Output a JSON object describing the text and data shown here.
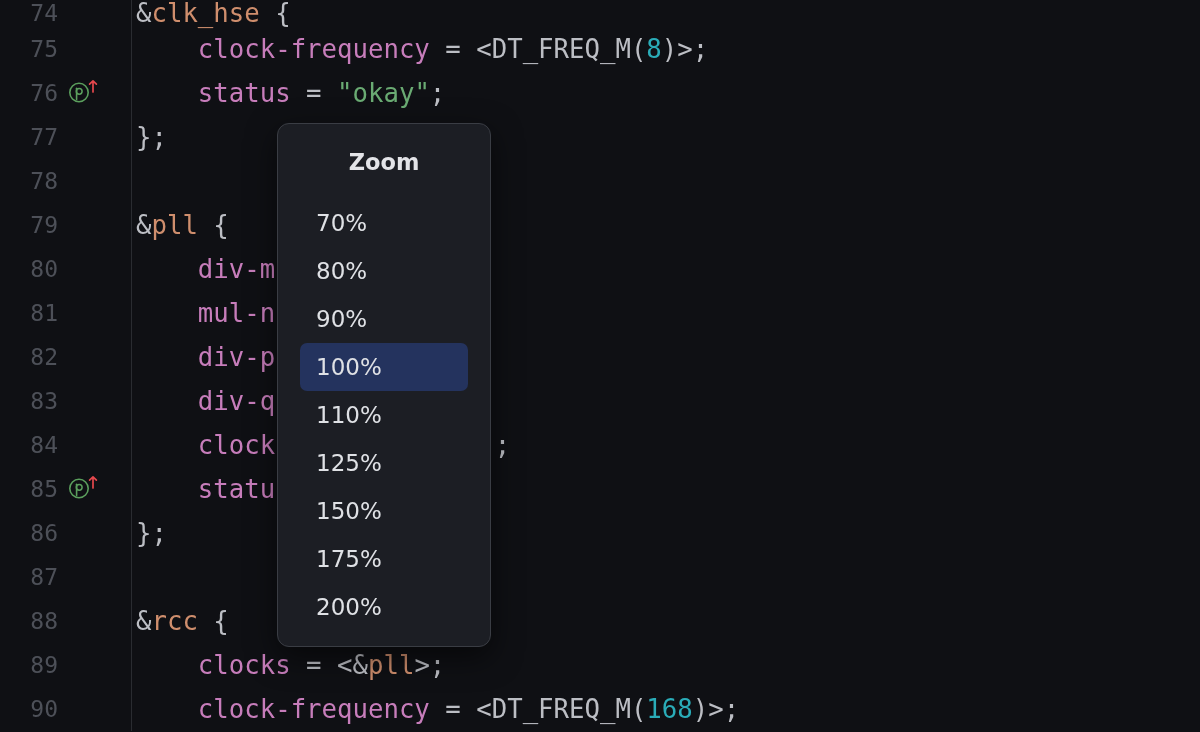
{
  "editor": {
    "lines": [
      {
        "number": "74",
        "marker": false,
        "tokens": [
          {
            "text": "&",
            "kind": "plain"
          },
          {
            "text": "clk_hse",
            "kind": "label"
          },
          {
            "text": " {",
            "kind": "plain"
          }
        ],
        "children": [
          {
            "number": "75",
            "marker": false,
            "tokens": [
              {
                "text": "clock-frequency",
                "kind": "property"
              },
              {
                "text": " = <DT_FREQ_M(",
                "kind": "plain"
              },
              {
                "text": "8",
                "kind": "number"
              },
              {
                "text": ")>;",
                "kind": "plain"
              }
            ]
          },
          {
            "number": "76",
            "marker": true,
            "tokens": [
              {
                "text": "status",
                "kind": "property"
              },
              {
                "text": " = ",
                "kind": "plain"
              },
              {
                "text": "\"okay\"",
                "kind": "string"
              },
              {
                "text": ";",
                "kind": "plain"
              }
            ]
          }
        ]
      },
      {
        "number": "77",
        "marker": false,
        "tokens": [
          {
            "text": "};",
            "kind": "plain"
          }
        ]
      },
      {
        "number": "78",
        "marker": false
      },
      {
        "number": "79",
        "marker": false,
        "tokens": [
          {
            "text": "&",
            "kind": "plain"
          },
          {
            "text": "pll",
            "kind": "label"
          },
          {
            "text": " {",
            "kind": "plain"
          }
        ],
        "children": [
          {
            "number": "80",
            "marker": false,
            "tokens": [
              {
                "text": "div-m",
                "kind": "property"
              }
            ]
          },
          {
            "number": "81",
            "marker": false,
            "tokens": [
              {
                "text": "mul-n",
                "kind": "property"
              }
            ]
          },
          {
            "number": "82",
            "marker": false,
            "tokens": [
              {
                "text": "div-p",
                "kind": "property"
              }
            ]
          },
          {
            "number": "83",
            "marker": false,
            "tokens": [
              {
                "text": "div-q",
                "kind": "property"
              }
            ]
          },
          {
            "number": "84",
            "marker": false,
            "tokens": [
              {
                "text": "clock",
                "kind": "property"
              }
            ],
            "after_popup": [
              {
                "text": ";",
                "kind": "plain"
              }
            ]
          },
          {
            "number": "85",
            "marker": true,
            "tokens": [
              {
                "text": "statu",
                "kind": "property"
              }
            ]
          }
        ]
      },
      {
        "number": "86",
        "marker": false,
        "tokens": [
          {
            "text": "};",
            "kind": "plain"
          }
        ]
      },
      {
        "number": "87",
        "marker": false
      },
      {
        "number": "88",
        "marker": false,
        "tokens": [
          {
            "text": "&",
            "kind": "plain"
          },
          {
            "text": "rcc",
            "kind": "label"
          },
          {
            "text": " {",
            "kind": "plain"
          }
        ],
        "children": [
          {
            "number": "89",
            "marker": false,
            "tokens": [
              {
                "text": "clocks",
                "kind": "property"
              },
              {
                "text": " = <&",
                "kind": "plain"
              },
              {
                "text": "pll",
                "kind": "label"
              },
              {
                "text": ">;",
                "kind": "plain"
              }
            ]
          },
          {
            "number": "90",
            "marker": false,
            "tokens": [
              {
                "text": "clock-frequency",
                "kind": "property"
              },
              {
                "text": " = <DT_FREQ_M(",
                "kind": "plain"
              },
              {
                "text": "168",
                "kind": "number"
              },
              {
                "text": ")>;",
                "kind": "plain"
              }
            ]
          }
        ]
      }
    ]
  },
  "zoom_menu": {
    "title": "Zoom",
    "options": [
      {
        "label": "70%",
        "selected": false
      },
      {
        "label": "80%",
        "selected": false
      },
      {
        "label": "90%",
        "selected": false
      },
      {
        "label": "100%",
        "selected": true
      },
      {
        "label": "110%",
        "selected": false
      },
      {
        "label": "125%",
        "selected": false
      },
      {
        "label": "150%",
        "selected": false
      },
      {
        "label": "175%",
        "selected": false
      },
      {
        "label": "200%",
        "selected": false
      }
    ]
  }
}
